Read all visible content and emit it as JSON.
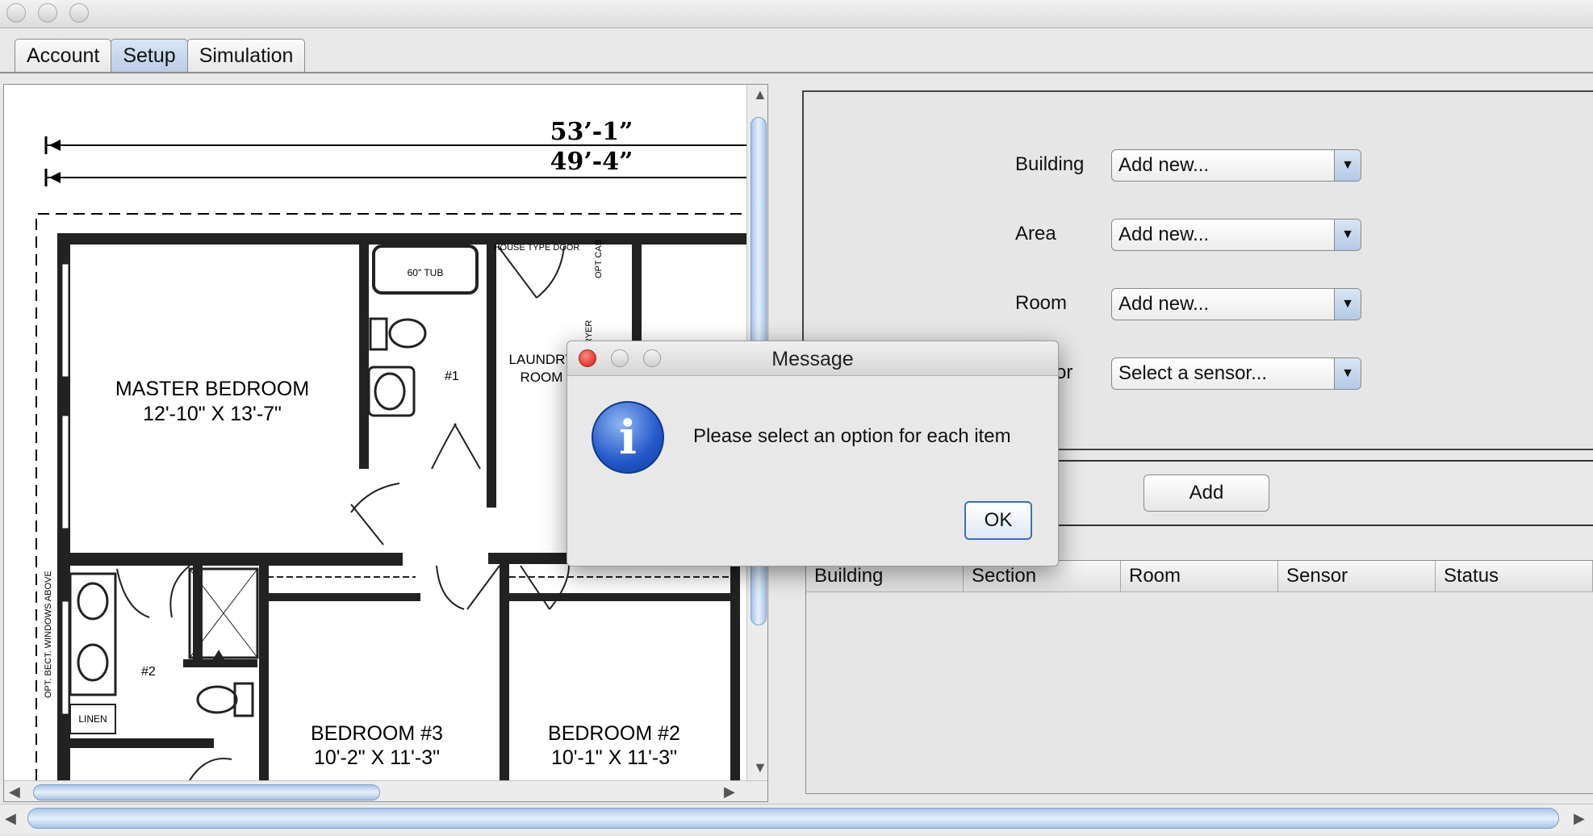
{
  "tabs": [
    "Account",
    "Setup",
    "Simulation"
  ],
  "active_tab": "Setup",
  "floorplan": {
    "dim_outer": "53’-1”",
    "dim_inner": "49’-4”",
    "master_bedroom": {
      "name": "MASTER BEDROOM",
      "size": "12'-10\" X 13'-7\""
    },
    "bedroom3": {
      "name": "BEDROOM #3",
      "size": "10'-2\" X 11'-3\""
    },
    "bedroom2": {
      "name": "BEDROOM #2",
      "size": "10'-1\" X 11'-3\""
    },
    "laundry": {
      "line1": "LAUNDRY",
      "line2": "ROOM"
    },
    "tub": "60\" TUB",
    "bath1": "#1",
    "bath2": "#2",
    "linen": "LINEN",
    "door_note": "HOUSE TYPE DOOR",
    "cab": "OPT CAB",
    "dryer": "DRYER",
    "windows_note": "OPT. BECT. WINDOWS ABOVE"
  },
  "form": {
    "building": {
      "label": "Building",
      "value": "Add new..."
    },
    "area": {
      "label": "Area",
      "value": "Add new..."
    },
    "room": {
      "label": "Room",
      "value": "Add new..."
    },
    "sensor": {
      "label": "or",
      "value": "Select a sensor..."
    }
  },
  "add_button": "Add",
  "table": {
    "headers": [
      "Building",
      "Section",
      "Room",
      "Sensor",
      "Status"
    ]
  },
  "dialog": {
    "title": "Message",
    "message": "Please select an option for each item",
    "ok": "OK"
  },
  "icons": [
    "info-icon",
    "chevron-down-icon",
    "arrow-up-icon",
    "arrow-down-icon",
    "arrow-left-icon",
    "arrow-right-icon"
  ],
  "colors": {
    "accent": "#b9cde6",
    "close_red": "#e0443e",
    "info_blue": "#2457c8"
  }
}
